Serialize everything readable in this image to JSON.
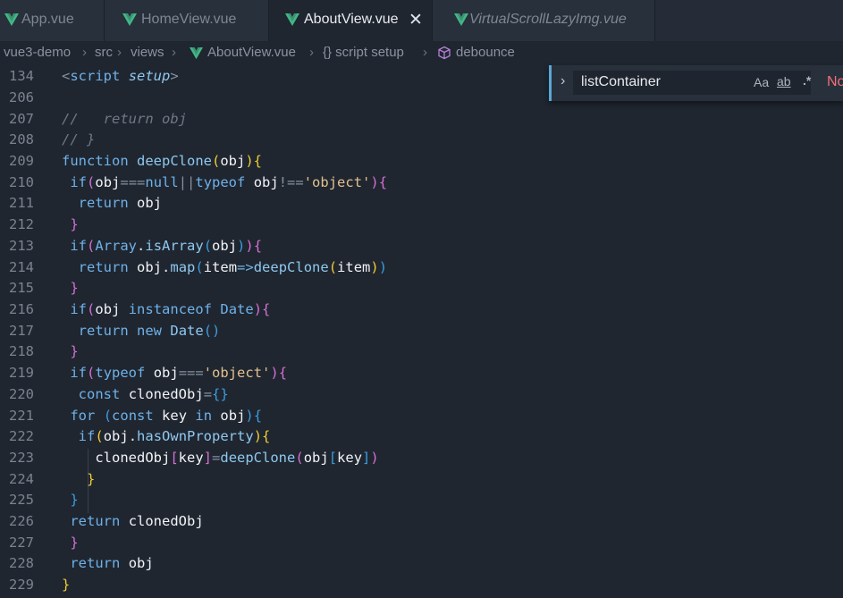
{
  "tabs": [
    {
      "label": "App.vue",
      "active": false
    },
    {
      "label": "HomeView.vue",
      "active": false
    },
    {
      "label": "AboutView.vue",
      "active": true
    },
    {
      "label": "VirtualScrollLazyImg.vue",
      "active": false
    }
  ],
  "close_glyph": "✕",
  "breadcrumb": {
    "items": [
      "vue3-demo",
      "src",
      "views",
      "AboutView.vue",
      "{} script setup",
      "debounce"
    ],
    "separator": "›"
  },
  "find_widget": {
    "value": "listContainer",
    "opt_case": "Aa",
    "opt_word": "ab",
    "opt_regex": ".*",
    "result": "No"
  },
  "code": {
    "lines": [
      "134",
      "206",
      "207",
      "208",
      "209",
      "210",
      "211",
      "212",
      "213",
      "214",
      "215",
      "216",
      "217",
      "218",
      "219",
      "220",
      "221",
      "222",
      "223",
      "224",
      "225",
      "226",
      "227",
      "228",
      "229"
    ]
  },
  "colors": {
    "background": "#1f2630",
    "vue_green": "#41b883",
    "keyword": "#6fb1e8",
    "string": "#e2c08d",
    "comment": "#6f7885",
    "bracket_1": "#f1cc35",
    "bracket_2": "#d76fd3",
    "bracket_3": "#3b9de0"
  }
}
